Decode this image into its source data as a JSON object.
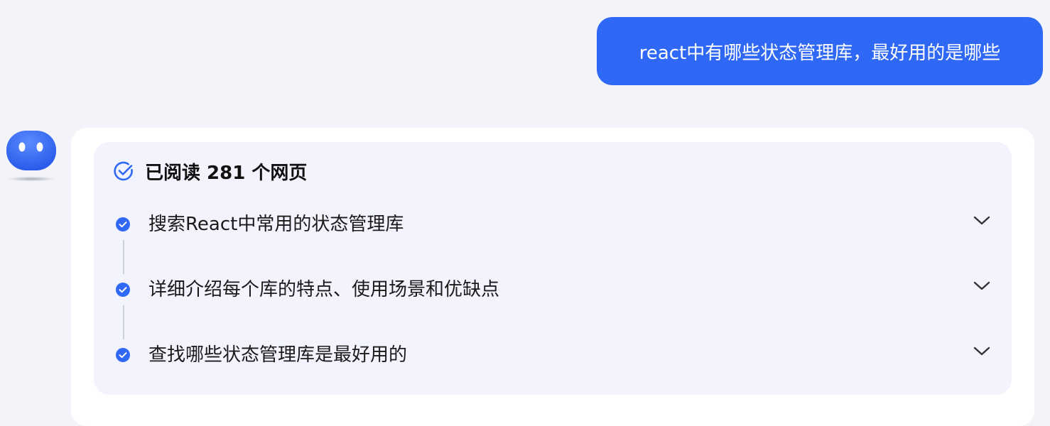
{
  "user_message": {
    "text": "react中有哪些状态管理库，最好用的是哪些"
  },
  "assistant": {
    "avatar_icon": "robot-avatar-icon",
    "reading_panel": {
      "title": "已阅读 281 个网页",
      "status_icon": "check-circle-icon",
      "steps": [
        {
          "label": "搜索React中常用的状态管理库"
        },
        {
          "label": "详细介绍每个库的特点、使用场景和优缺点"
        },
        {
          "label": "查找哪些状态管理库是最好用的"
        }
      ]
    }
  },
  "colors": {
    "accent": "#2f68f5",
    "page_bg": "#f3f4f9",
    "panel_bg": "#f2f3fd"
  }
}
